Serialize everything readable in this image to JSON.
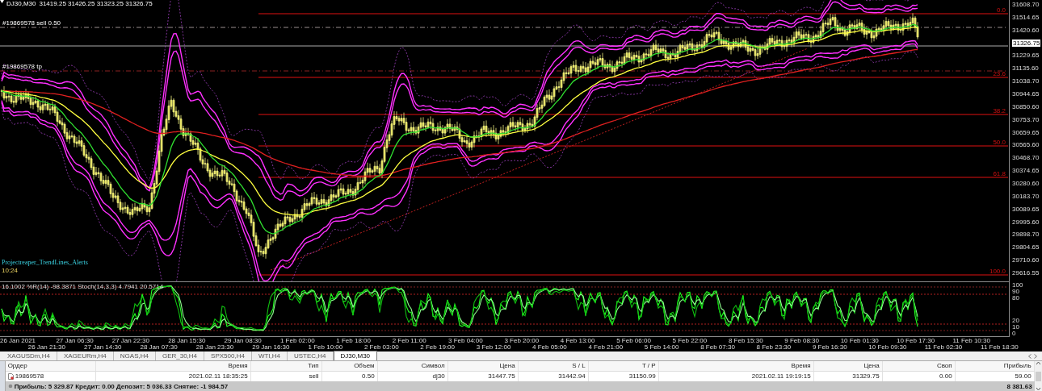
{
  "chart": {
    "symbol": "DJ30,M30",
    "ohlc": "31419.25 31426.25 31323.25 31326.75",
    "order_labels": [
      "#19869578 sell 0.50",
      "#19869578 tp"
    ],
    "fib_levels": [
      "0.0",
      "23.6",
      "38.2",
      "50.0",
      "61.8",
      "100.0"
    ],
    "indicator_name": "Projectreaper_TrendLines_Alerts",
    "timer": "10:24",
    "price_axis": [
      {
        "text": "31608.70",
        "current": false
      },
      {
        "text": "31514.65",
        "current": false
      },
      {
        "text": "31420.60",
        "current": false
      },
      {
        "text": "31326.75",
        "current": true
      },
      {
        "text": "31229.65",
        "current": false
      },
      {
        "text": "31135.60",
        "current": false
      },
      {
        "text": "31038.70",
        "current": false
      },
      {
        "text": "30944.65",
        "current": false
      },
      {
        "text": "30850.60",
        "current": false
      },
      {
        "text": "30753.70",
        "current": false
      },
      {
        "text": "30659.65",
        "current": false
      },
      {
        "text": "30565.60",
        "current": false
      },
      {
        "text": "30468.70",
        "current": false
      },
      {
        "text": "30374.65",
        "current": false
      },
      {
        "text": "30280.60",
        "current": false
      },
      {
        "text": "30183.70",
        "current": false
      },
      {
        "text": "30089.65",
        "current": false
      },
      {
        "text": "29995.60",
        "current": false
      },
      {
        "text": "29898.70",
        "current": false
      },
      {
        "text": "29804.65",
        "current": false
      },
      {
        "text": "29710.60",
        "current": false
      },
      {
        "text": "29616.55",
        "current": false
      }
    ],
    "oscillator": {
      "label": "16.1002  %R(14) -98.3871  Stoch(14,3,3) 4.7941 20.5714",
      "axis": [
        "100",
        "90",
        "80",
        "20",
        "10",
        "0"
      ]
    },
    "time_axis": [
      "26 Jan 2021",
      "26 Jan 21:30",
      "27 Jan 06:30",
      "27 Jan 14:30",
      "27 Jan 22:30",
      "28 Jan 07:30",
      "28 Jan 15:30",
      "28 Jan 23:30",
      "29 Jan 08:30",
      "29 Jan 16:30",
      "1 Feb 02:00",
      "1 Feb 10:00",
      "1 Feb 18:00",
      "2 Feb 03:00",
      "2 Feb 11:00",
      "2 Feb 19:00",
      "3 Feb 04:00",
      "3 Feb 12:00",
      "3 Feb 20:00",
      "4 Feb 05:00",
      "4 Feb 13:00",
      "4 Feb 21:00",
      "5 Feb 06:00",
      "5 Feb 14:00",
      "5 Feb 22:00",
      "8 Feb 07:30",
      "8 Feb 15:30",
      "8 Feb 23:30",
      "9 Feb 08:30",
      "9 Feb 16:30",
      "10 Feb 01:30",
      "10 Feb 09:30",
      "10 Feb 17:30",
      "11 Feb 02:30",
      "11 Feb 10:30",
      "11 Feb 18:30"
    ]
  },
  "tabs": [
    {
      "label": "XAGUSDm,H4",
      "selected": false
    },
    {
      "label": "XAGEURm,H4",
      "selected": false
    },
    {
      "label": "NGAS,H4",
      "selected": false
    },
    {
      "label": "GER_30,H4",
      "selected": false
    },
    {
      "label": "SPX500,H4",
      "selected": false
    },
    {
      "label": "WTI,H4",
      "selected": false
    },
    {
      "label": "USTEC,H4",
      "selected": false
    },
    {
      "label": "DJ30,M30",
      "selected": true
    }
  ],
  "orders": {
    "columns": [
      "Ордер",
      "Время",
      "Тип",
      "Объем",
      "Символ",
      "Цена",
      "S / L",
      "T / P",
      "Время",
      "Цена",
      "Своп",
      "Прибыль"
    ],
    "rows": [
      [
        "19869578",
        "2021.02.11 18:35:25",
        "sell",
        "0.50",
        "dj30",
        "31447.75",
        "31442.94",
        "31150.99",
        "2021.02.11 19:19:15",
        "31329.75",
        "0.00",
        "59.00"
      ]
    ],
    "summary": {
      "text": "Прибыль: 5 329.87  Кредит: 0.00  Депозит: 5 036.33  Снятие: -1 984.57",
      "total": "8 381.63"
    }
  }
}
